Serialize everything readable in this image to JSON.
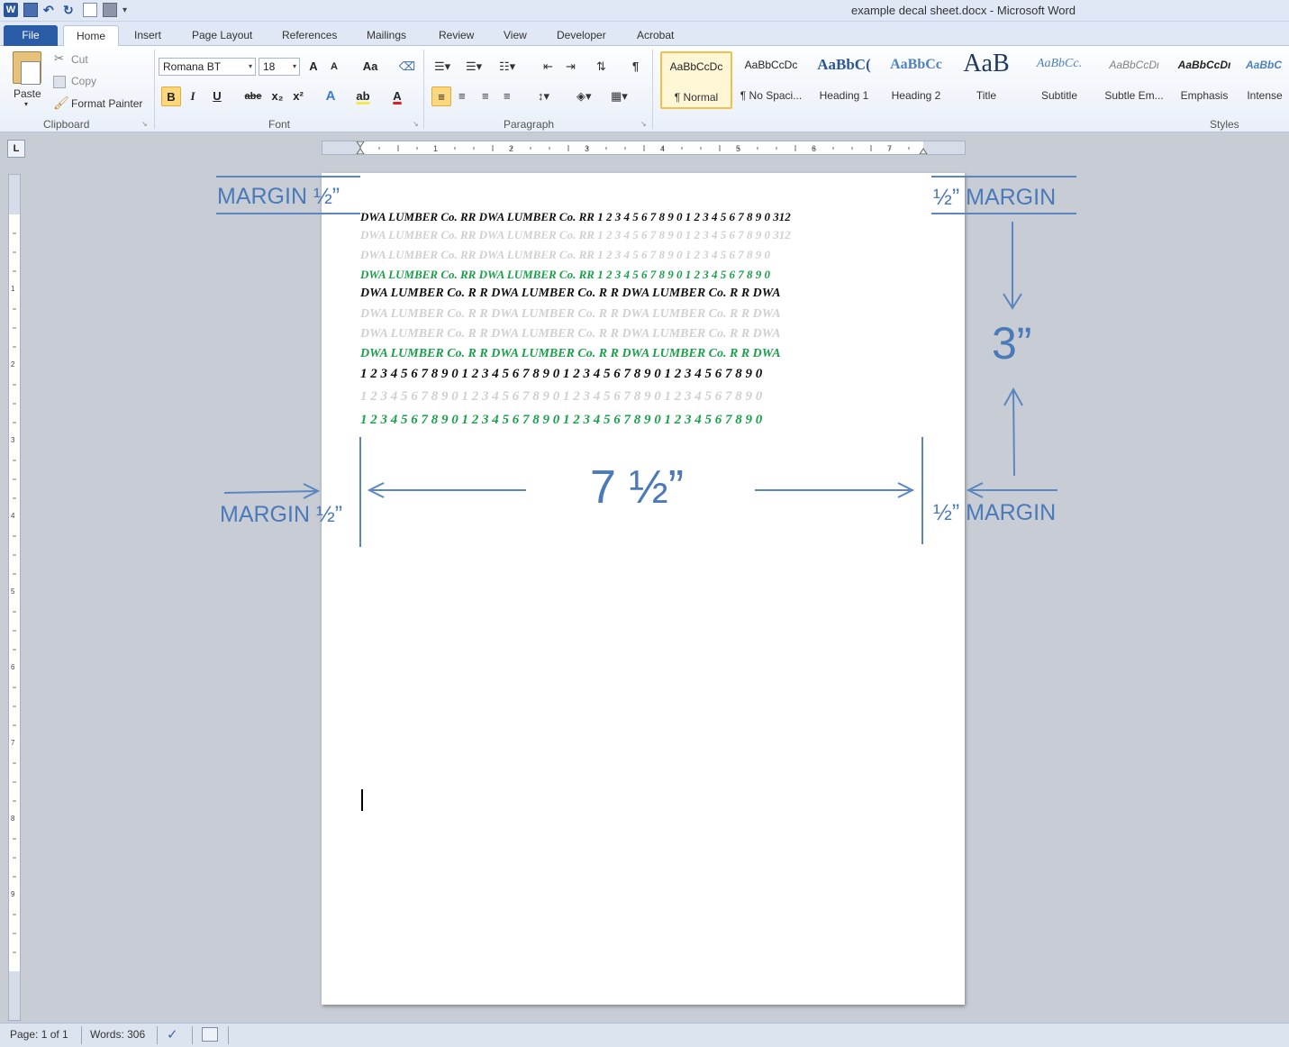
{
  "window": {
    "title": "example decal sheet.docx - Microsoft Word"
  },
  "tabs": [
    "File",
    "Home",
    "Insert",
    "Page Layout",
    "References",
    "Mailings",
    "Review",
    "View",
    "Developer",
    "Acrobat"
  ],
  "clipboard": {
    "paste": "Paste",
    "cut": "Cut",
    "copy": "Copy",
    "format_painter": "Format Painter",
    "label": "Clipboard"
  },
  "font": {
    "name": "Romana BT",
    "size": "18",
    "label": "Font",
    "grow": "A",
    "shrink": "A",
    "case": "Aa",
    "bold": "B",
    "italic": "I",
    "underline": "U",
    "strike": "abe",
    "sub": "x₂",
    "sup": "x²",
    "highlight": "ab",
    "color": "A"
  },
  "paragraph": {
    "label": "Paragraph"
  },
  "styles": {
    "label": "Styles",
    "items": [
      {
        "preview": "AaBbCcDc",
        "name": "¶ Normal"
      },
      {
        "preview": "AaBbCcDc",
        "name": "¶ No Spaci..."
      },
      {
        "preview": "AaBbC(",
        "name": "Heading 1"
      },
      {
        "preview": "AaBbCc",
        "name": "Heading 2"
      },
      {
        "preview": "AaB",
        "name": "Title"
      },
      {
        "preview": "AaBbCc.",
        "name": "Subtitle"
      },
      {
        "preview": "AaBbCcDι",
        "name": "Subtle Em..."
      },
      {
        "preview": "AaBbCcDι",
        "name": "Emphasis"
      },
      {
        "preview": "AaBbC",
        "name": "Intense"
      }
    ]
  },
  "document": {
    "lines": [
      {
        "text": "DWA LUMBER Co. RR    DWA LUMBER Co. RR      1 2 3 4 5 6 7 8 9 0  1 2 3 4 5 6 7 8 9 0 312",
        "color": "black"
      },
      {
        "text": "DWA LUMBER Co. RR    DWA LUMBER Co. RR      1 2 3 4 5 6 7 8 9 0  1 2 3 4 5 6 7 8 9 0 312",
        "color": "gray"
      },
      {
        "text": "DWA LUMBER Co. RR    DWA LUMBER Co. RR      1 2 3 4 5 6 7 8 9 0   1 2 3 4 5 6 7 8 9 0",
        "color": "gray"
      },
      {
        "text": "DWA LUMBER Co. RR    DWA LUMBER Co. RR      1 2 3 4 5 6 7 8 9 0   1 2 3 4 5 6 7 8 9 0",
        "color": "green"
      },
      {
        "text": "DWA  LUMBER  Co.  R R   DWA  LUMBER  Co.  R R  DWA  LUMBER  Co.  R R DWA",
        "color": "black"
      },
      {
        "text": "DWA  LUMBER  Co.  R R   DWA  LUMBER  Co.  R R  DWA  LUMBER  Co.  R R DWA",
        "color": "gray"
      },
      {
        "text": "DWA  LUMBER  Co.  R R   DWA  LUMBER  Co.  R R  DWA  LUMBER  Co.  R R DWA",
        "color": "gray"
      },
      {
        "text": "DWA  LUMBER  Co.  R R   DWA  LUMBER  Co.  R R  DWA  LUMBER  Co.  R R DWA",
        "color": "green"
      },
      {
        "text": "1 2 3 4 5 6 7 8 9 0    1 2 3 4 5 6 7 8 9 0    1 2 3 4 5 6 7 8 9 0    1 2 3 4 5 6 7 8 9 0",
        "color": "black"
      },
      {
        "text": "1 2 3 4 5 6 7 8 9 0   1 2 3 4 5 6 7 8 9 0   1 2 3 4 5 6 7 8 9 0   1 2 3 4 5 6 7 8 9 0",
        "color": "gray"
      },
      {
        "text": "1 2 3 4 5 6 7 8 9 0    1 2 3 4 5 6 7 8 9 0    1 2 3 4 5 6 7 8 9 0    1 2 3 4 5 6 7 8 9 0",
        "color": "green"
      }
    ]
  },
  "annotations": {
    "margin_top_left": "MARGIN ½”",
    "margin_top_right": "½” MARGIN",
    "height": "3”",
    "width": "7 ½”",
    "margin_bottom_left": "MARGIN ½”",
    "margin_bottom_right": "½” MARGIN"
  },
  "status": {
    "page": "Page: 1 of 1",
    "words": "Words: 306"
  },
  "colors": {
    "annotation": "#4a7ab9",
    "green_text": "#1aa04a",
    "gray_text": "#d0d0d0",
    "file_tab": "#2a5ba6"
  }
}
